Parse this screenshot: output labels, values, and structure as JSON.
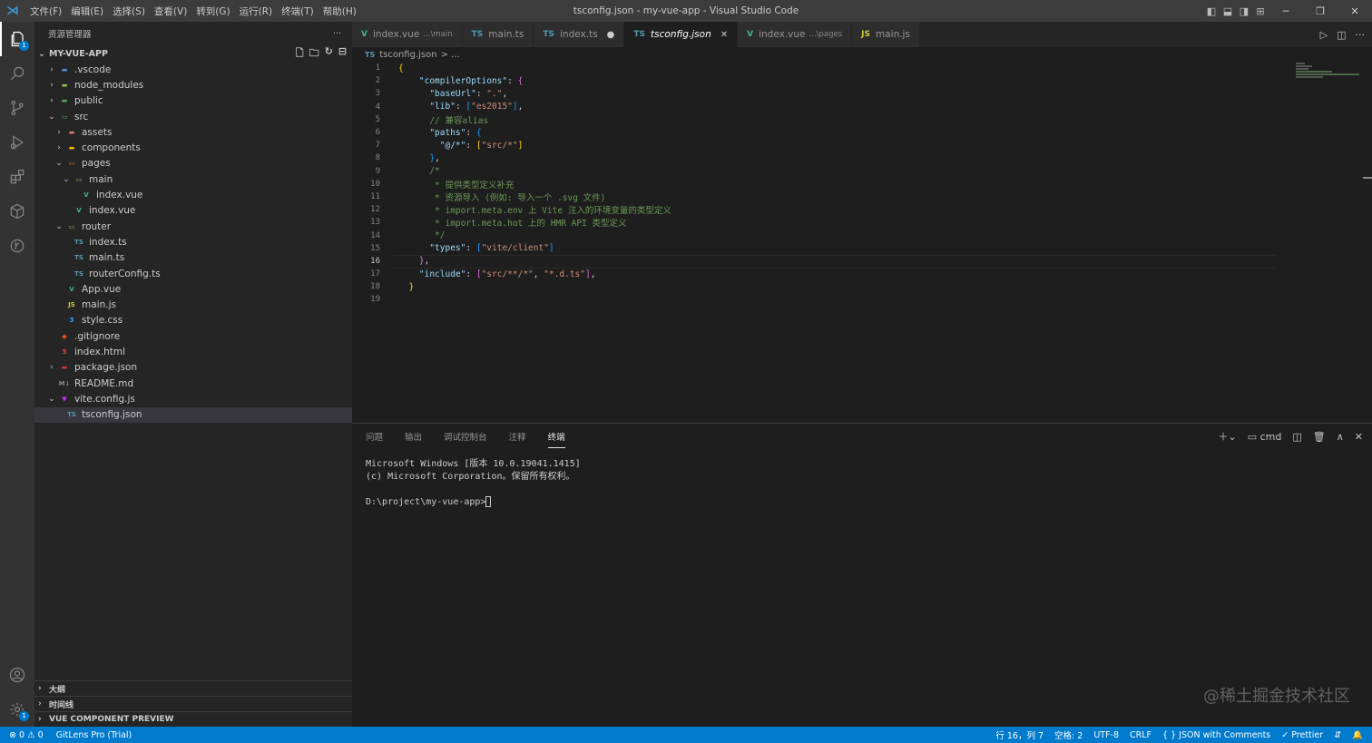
{
  "window": {
    "title": "tsconfig.json - my-vue-app - Visual Studio Code",
    "menu": [
      "文件(F)",
      "编辑(E)",
      "选择(S)",
      "查看(V)",
      "转到(G)",
      "运行(R)",
      "终端(T)",
      "帮助(H)"
    ]
  },
  "activity": {
    "explorer_badge": "1",
    "settings_badge": "1"
  },
  "sidebar": {
    "header": "资源管理器",
    "more": "···",
    "project": "MY-VUE-APP",
    "tree": [
      {
        "label": ".vscode",
        "indent": 0,
        "chev": "›",
        "icon": "folder",
        "color": "#4f8fd8"
      },
      {
        "label": "node_modules",
        "indent": 0,
        "chev": "›",
        "icon": "folder",
        "color": "#8bc34a"
      },
      {
        "label": "public",
        "indent": 0,
        "chev": "›",
        "icon": "folder",
        "color": "#4caf50"
      },
      {
        "label": "src",
        "indent": 0,
        "chev": "⌄",
        "icon": "folder-open",
        "color": "#4caf50"
      },
      {
        "label": "assets",
        "indent": 1,
        "chev": "›",
        "icon": "folder",
        "color": "#e57373"
      },
      {
        "label": "components",
        "indent": 1,
        "chev": "›",
        "icon": "folder",
        "color": "#ffb300"
      },
      {
        "label": "pages",
        "indent": 1,
        "chev": "⌄",
        "icon": "folder-open",
        "color": "#ef6c00"
      },
      {
        "label": "main",
        "indent": 2,
        "chev": "⌄",
        "icon": "folder-open",
        "color": "#c7a46b"
      },
      {
        "label": "index.vue",
        "indent": 3,
        "chev": "",
        "icon": "vue",
        "color": "#41b883"
      },
      {
        "label": "index.vue",
        "indent": 2,
        "chev": "",
        "icon": "vue",
        "color": "#41b883"
      },
      {
        "label": "router",
        "indent": 1,
        "chev": "⌄",
        "icon": "folder-open",
        "color": "#c7a46b"
      },
      {
        "label": "index.ts",
        "indent": 2,
        "chev": "",
        "icon": "ts",
        "color": "#519aba"
      },
      {
        "label": "main.ts",
        "indent": 2,
        "chev": "",
        "icon": "ts",
        "color": "#519aba"
      },
      {
        "label": "routerConfig.ts",
        "indent": 2,
        "chev": "",
        "icon": "ts",
        "color": "#519aba"
      },
      {
        "label": "App.vue",
        "indent": 1,
        "chev": "",
        "icon": "vue",
        "color": "#41b883"
      },
      {
        "label": "main.js",
        "indent": 1,
        "chev": "",
        "icon": "js",
        "color": "#cbcb41"
      },
      {
        "label": "style.css",
        "indent": 1,
        "chev": "",
        "icon": "css",
        "color": "#42a5f5"
      },
      {
        "label": ".gitignore",
        "indent": 0,
        "chev": "",
        "icon": "git",
        "color": "#f4511e"
      },
      {
        "label": "index.html",
        "indent": 0,
        "chev": "",
        "icon": "html",
        "color": "#e44d26"
      },
      {
        "label": "package.json",
        "indent": 0,
        "chev": "›",
        "icon": "npm",
        "color": "#cb3837"
      },
      {
        "label": "README.md",
        "indent": 0,
        "chev": "",
        "icon": "md",
        "color": "#888888"
      },
      {
        "label": "vite.config.js",
        "indent": 0,
        "chev": "⌄",
        "icon": "vite",
        "color": "#bd34fe"
      },
      {
        "label": "tsconfig.json",
        "indent": 1,
        "chev": "",
        "icon": "ts",
        "color": "#519aba",
        "selected": true
      }
    ],
    "sections": [
      "大纲",
      "时间线",
      "VUE COMPONENT PREVIEW"
    ]
  },
  "tabs": [
    {
      "label": "index.vue",
      "desc": "...\\main",
      "icon": "V",
      "color": "#41b883"
    },
    {
      "label": "main.ts",
      "desc": "",
      "icon": "TS",
      "color": "#519aba"
    },
    {
      "label": "index.ts",
      "desc": "",
      "icon": "TS",
      "color": "#519aba",
      "dirty": "●"
    },
    {
      "label": "tsconfig.json",
      "desc": "",
      "icon": "TS",
      "color": "#519aba",
      "active": true,
      "close": "✕"
    },
    {
      "label": "index.vue",
      "desc": "...\\pages",
      "icon": "V",
      "color": "#41b883"
    },
    {
      "label": "main.js",
      "desc": "",
      "icon": "JS",
      "color": "#cbcb41"
    }
  ],
  "breadcrumb": {
    "file": "tsconfig.json",
    "rest": "> ..."
  },
  "code": [
    {
      "n": "1",
      "html": "<span class='b1'>{</span>"
    },
    {
      "n": "2",
      "html": "    <span class='k'>\"compilerOptions\"</span>: <span class='b2'>{</span>"
    },
    {
      "n": "3",
      "html": "      <span class='k'>\"baseUrl\"</span>: <span class='s'>\".\"</span>,"
    },
    {
      "n": "4",
      "html": "      <span class='k'>\"lib\"</span>: <span class='b3'>[</span><span class='s'>\"es2015\"</span><span class='b3'>]</span>,"
    },
    {
      "n": "5",
      "html": "      <span class='c'>// 兼容alias</span>"
    },
    {
      "n": "6",
      "html": "      <span class='k'>\"paths\"</span>: <span class='b3'>{</span>"
    },
    {
      "n": "7",
      "html": "        <span class='k'>\"@/*\"</span>: <span class='b1'>[</span><span class='s'>\"src/*\"</span><span class='b1'>]</span>"
    },
    {
      "n": "8",
      "html": "      <span class='b3'>}</span>,"
    },
    {
      "n": "9",
      "html": "      <span class='c'>/*</span>"
    },
    {
      "n": "10",
      "html": "      <span class='c'> * 提供类型定义补充</span>"
    },
    {
      "n": "11",
      "html": "      <span class='c'> * 资源导入 (例如: 导入一个 .svg 文件)</span>"
    },
    {
      "n": "12",
      "html": "      <span class='c'> * import.meta.env 上 Vite 注入的环境变量的类型定义</span>"
    },
    {
      "n": "13",
      "html": "      <span class='c'> * import.meta.hot 上的 HMR API 类型定义</span>"
    },
    {
      "n": "14",
      "html": "      <span class='c'> */</span>"
    },
    {
      "n": "15",
      "html": "      <span class='k'>\"types\"</span>: <span class='b3'>[</span><span class='s'>\"vite/client\"</span><span class='b3'>]</span>"
    },
    {
      "n": "16",
      "html": "    <span class='b2'>}</span>,",
      "cur": true
    },
    {
      "n": "17",
      "html": "    <span class='k'>\"include\"</span>: <span class='b2'>[</span><span class='s'>\"src/**/*\"</span>, <span class='s'>\"*.d.ts\"</span><span class='b2'>]</span>,"
    },
    {
      "n": "18",
      "html": "  <span class='b1'>}</span>"
    },
    {
      "n": "19",
      "html": ""
    }
  ],
  "panel": {
    "tabs": [
      "问题",
      "输出",
      "调试控制台",
      "注释",
      "终端"
    ],
    "active_tab": "终端",
    "shell": "cmd",
    "terminal_lines": [
      "Microsoft Windows [版本 10.0.19041.1415]",
      "(c) Microsoft Corporation。保留所有权利。",
      "",
      "D:\\project\\my-vue-app>"
    ]
  },
  "watermark": "@稀土掘金技术社区",
  "status": {
    "errors": "⊗ 0",
    "warnings": "⚠ 0",
    "gitlens": "GitLens Pro (Trial)",
    "position": "行 16，列 7",
    "spaces": "空格: 2",
    "encoding": "UTF-8",
    "eol": "CRLF",
    "language": "{ } JSON with Comments",
    "prettier": "✓ Prettier"
  }
}
